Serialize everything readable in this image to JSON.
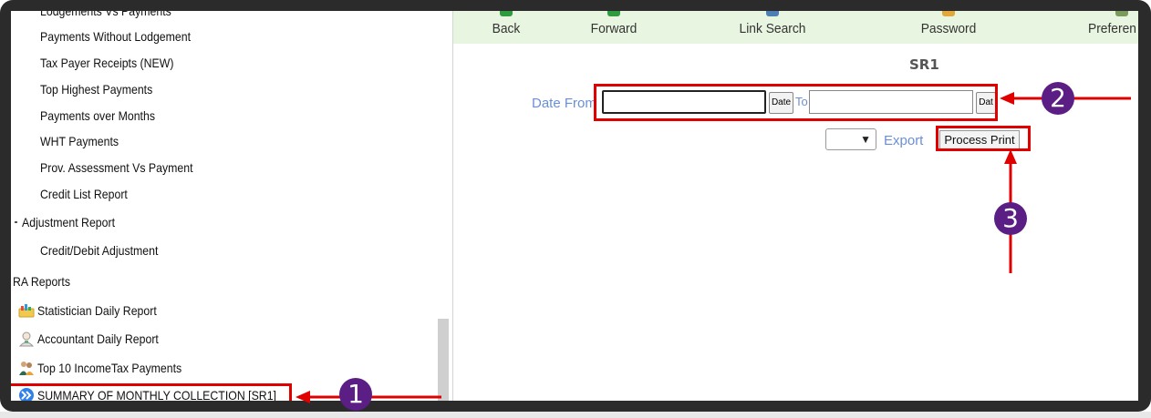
{
  "sidebar": {
    "items": [
      {
        "label": "Lodgements Vs Payments",
        "level": 2
      },
      {
        "label": "Payments Without Lodgement",
        "level": 2
      },
      {
        "label": "Tax Payer Receipts (NEW)",
        "level": 2
      },
      {
        "label": "Top Highest Payments",
        "level": 2
      },
      {
        "label": "Payments over Months",
        "level": 2
      },
      {
        "label": "WHT Payments",
        "level": 2
      },
      {
        "label": "Prov. Assessment Vs Payment",
        "level": 2
      },
      {
        "label": "Credit List Report",
        "level": 2
      },
      {
        "label": "Adjustment Report",
        "level": 1
      },
      {
        "label": "Credit/Debit Adjustment",
        "level": 2
      },
      {
        "label": "RA Reports",
        "level": 0
      }
    ],
    "icon_items": [
      {
        "label": "Statistician Daily Report",
        "icon": "folder-chart-icon"
      },
      {
        "label": "Accountant Daily Report",
        "icon": "accountant-icon"
      },
      {
        "label": "Top 10 IncomeTax Payments",
        "icon": "people-icon"
      },
      {
        "label": "SUMMARY OF MONTHLY COLLECTION [SR1]",
        "icon": "double-chevron-icon"
      }
    ]
  },
  "toolbar": {
    "back": "Back",
    "forward": "Forward",
    "link_search": "Link Search",
    "password": "Password",
    "preferences": "Preferen"
  },
  "report": {
    "title": "SR1",
    "date_from_label": "Date From",
    "date_from_value": "",
    "date_btn": "Date",
    "to_label": "To",
    "date_to_value": "",
    "date_btn_2": "Dat",
    "export_select_value": "",
    "export_label": "Export",
    "process_print": "Process Print"
  },
  "annotations": {
    "badge_1": "1",
    "badge_2": "2",
    "badge_3": "3"
  },
  "colors": {
    "annotation_red": "#e00000",
    "badge_purple": "#5b1e84",
    "toolbar_bg": "#e8f5e0",
    "link_blue": "#6a8fd8"
  }
}
